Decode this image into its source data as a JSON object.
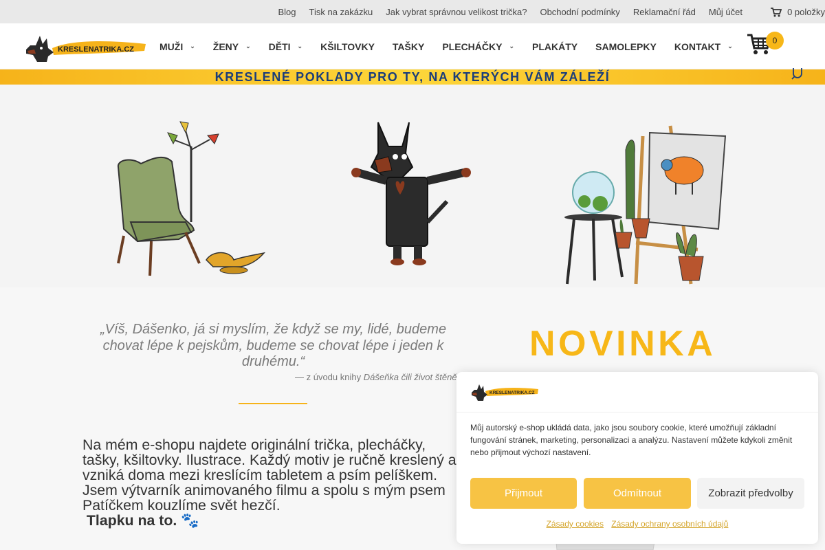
{
  "topbar": {
    "links": [
      "Blog",
      "Tisk na zakázku",
      "Jak vybrat správnou velikost trička?",
      "Obchodní podmínky",
      "Reklamační řád",
      "Můj účet"
    ],
    "cart_label": "0 položky"
  },
  "header": {
    "logo_text": "KRESLENATRIKA.CZ",
    "nav": [
      "MUŽI",
      "ŽENY",
      "DĚTI",
      "KŠILTOVKY",
      "TAŠKY",
      "PLECHÁČKY",
      "PLAKÁTY",
      "SAMOLEPKY",
      "KONTAKT"
    ],
    "nav_has_dropdown": [
      true,
      true,
      true,
      false,
      false,
      true,
      false,
      false,
      true
    ],
    "chevron": "⌄",
    "cart_count": "0"
  },
  "banner": {
    "text": "KRESLENÉ POKLADY PRO TY, NA KTERÝCH VÁM ZÁLEŽÍ"
  },
  "quote": {
    "text": "„Víš, Dášenko, já si myslím, že když se my, lidé, budeme chovat lépe k pejskům, budeme se chovat lépe i jeden k druhému.“",
    "attrib_prefix": "— z úvodu knihy ",
    "attrib_book": "Dášeňka čili život štěněte"
  },
  "intro": {
    "text": "Na mém e-shopu najdete originální trička, plecháčky, tašky, kšiltovky. Ilustrace. Každý motiv je ručně kreslený a vzniká doma mezi kreslícím tabletem a psím pelíškem. Jsem výtvarník animovaného filmu a spolu s mým psem Patíčkem kouzlíme svět hezčí.",
    "bold": "Tlapku na to. ",
    "paw_glyph": "🐾"
  },
  "novinka": "NOVINKA",
  "cookie": {
    "logo_text": "KRESLENATRIKA.CZ",
    "text": "Můj autorský e-shop ukládá data, jako jsou soubory cookie, které umožňují základní fungování stránek, marketing, personalizaci a analýzu. Nastavení můžete kdykoli změnit nebo přijmout výchozí nastavení.",
    "accept": "Přijmout",
    "deny": "Odmítnout",
    "prefs": "Zobrazit předvolby",
    "link_cookies": "Zásady cookies",
    "link_privacy": "Zásady ochrany osobních údajů"
  },
  "colors": {
    "accent": "#f7b718",
    "banner_text": "#1a3d7a",
    "topbar_bg": "#e9e9e9"
  },
  "icons": [
    "cart-icon",
    "shopping-cart-icon",
    "search-icon",
    "chevron-down-icon"
  ]
}
